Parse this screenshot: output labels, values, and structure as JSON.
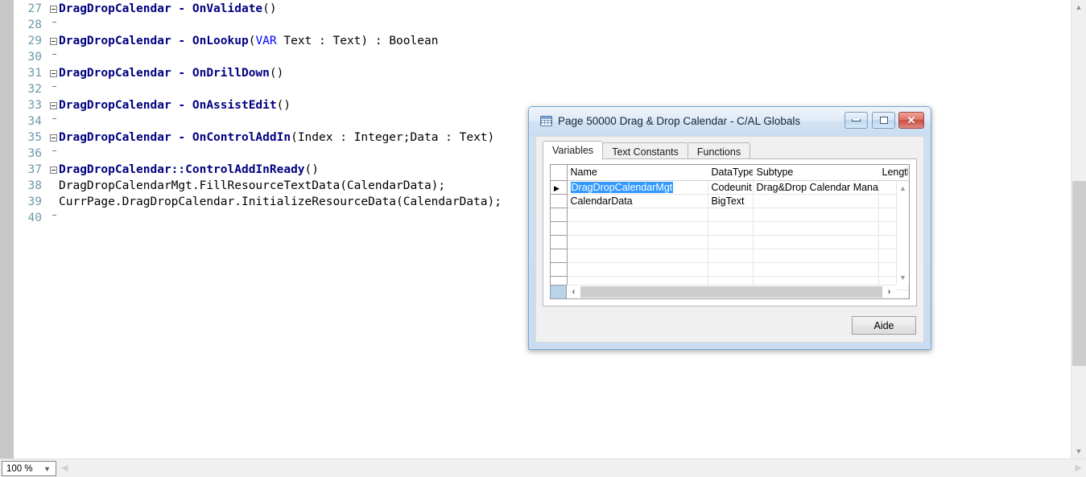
{
  "editor": {
    "zoom_value": "100 %",
    "lines": [
      {
        "num": "27",
        "fold": "box",
        "segments": [
          {
            "style": "hdr",
            "text": "DragDropCalendar - OnValidate"
          },
          {
            "style": "pln",
            "text": "()"
          }
        ]
      },
      {
        "num": "28",
        "fold": "bar-end",
        "segments": []
      },
      {
        "num": "29",
        "fold": "box",
        "segments": [
          {
            "style": "hdr",
            "text": "DragDropCalendar - OnLookup"
          },
          {
            "style": "pln",
            "text": "("
          },
          {
            "style": "kw",
            "text": "VAR"
          },
          {
            "style": "pln",
            "text": " Text : Text) : Boolean"
          }
        ]
      },
      {
        "num": "30",
        "fold": "bar-end",
        "segments": []
      },
      {
        "num": "31",
        "fold": "box",
        "segments": [
          {
            "style": "hdr",
            "text": "DragDropCalendar - OnDrillDown"
          },
          {
            "style": "pln",
            "text": "()"
          }
        ]
      },
      {
        "num": "32",
        "fold": "bar-end",
        "segments": []
      },
      {
        "num": "33",
        "fold": "box",
        "segments": [
          {
            "style": "hdr",
            "text": "DragDropCalendar - OnAssistEdit"
          },
          {
            "style": "pln",
            "text": "()"
          }
        ]
      },
      {
        "num": "34",
        "fold": "bar-end",
        "segments": []
      },
      {
        "num": "35",
        "fold": "box",
        "segments": [
          {
            "style": "hdr",
            "text": "DragDropCalendar - OnControlAddIn"
          },
          {
            "style": "pln",
            "text": "(Index : Integer;Data : Text)"
          }
        ]
      },
      {
        "num": "36",
        "fold": "bar-end",
        "segments": []
      },
      {
        "num": "37",
        "fold": "box",
        "segments": [
          {
            "style": "hdr",
            "text": "DragDropCalendar::ControlAddInReady"
          },
          {
            "style": "pln",
            "text": "()"
          }
        ]
      },
      {
        "num": "38",
        "fold": "bar",
        "segments": [
          {
            "style": "pln",
            "text": "DragDropCalendarMgt.FillResourceTextData(CalendarData);"
          }
        ]
      },
      {
        "num": "39",
        "fold": "bar",
        "segments": [
          {
            "style": "pln",
            "text": "CurrPage.DragDropCalendar.InitializeResourceData(CalendarData);"
          }
        ]
      },
      {
        "num": "40",
        "fold": "bar-end",
        "segments": []
      }
    ]
  },
  "dialog": {
    "title": "Page 50000 Drag & Drop Calendar - C/AL Globals",
    "window_buttons": {
      "minimize": "minimize-button",
      "maximize": "maximize-button",
      "close": "close-button"
    },
    "tabs": [
      {
        "label": "Variables",
        "active": true
      },
      {
        "label": "Text Constants",
        "active": false
      },
      {
        "label": "Functions",
        "active": false
      }
    ],
    "grid": {
      "columns": [
        "Name",
        "DataType",
        "Subtype",
        "Length"
      ],
      "rows": [
        {
          "marker": "▶",
          "selected": true,
          "Name": "DragDropCalendarMgt",
          "DataType": "Codeunit",
          "Subtype": "Drag&Drop Calendar Mana...",
          "Length": ""
        },
        {
          "marker": "",
          "selected": false,
          "Name": "CalendarData",
          "DataType": "BigText",
          "Subtype": "",
          "Length": ""
        },
        {
          "marker": "",
          "selected": false,
          "Name": "",
          "DataType": "",
          "Subtype": "",
          "Length": ""
        },
        {
          "marker": "",
          "selected": false,
          "Name": "",
          "DataType": "",
          "Subtype": "",
          "Length": ""
        },
        {
          "marker": "",
          "selected": false,
          "Name": "",
          "DataType": "",
          "Subtype": "",
          "Length": ""
        },
        {
          "marker": "",
          "selected": false,
          "Name": "",
          "DataType": "",
          "Subtype": "",
          "Length": ""
        },
        {
          "marker": "",
          "selected": false,
          "Name": "",
          "DataType": "",
          "Subtype": "",
          "Length": ""
        },
        {
          "marker": "",
          "selected": false,
          "Name": "",
          "DataType": "",
          "Subtype": "",
          "Length": ""
        },
        {
          "marker": "",
          "selected": false,
          "Name": "",
          "DataType": "",
          "Subtype": "",
          "Length": ""
        }
      ]
    },
    "help_button_label": "Aide"
  },
  "colors": {
    "code_header": "#000080",
    "code_keyword": "#0000ff",
    "line_number": "#6b9aa8",
    "selection": "#3399ff",
    "dialog_frame": "#7aa7d3",
    "close_button": "#cb4c42",
    "grid_corner": "#b8d3ea"
  }
}
